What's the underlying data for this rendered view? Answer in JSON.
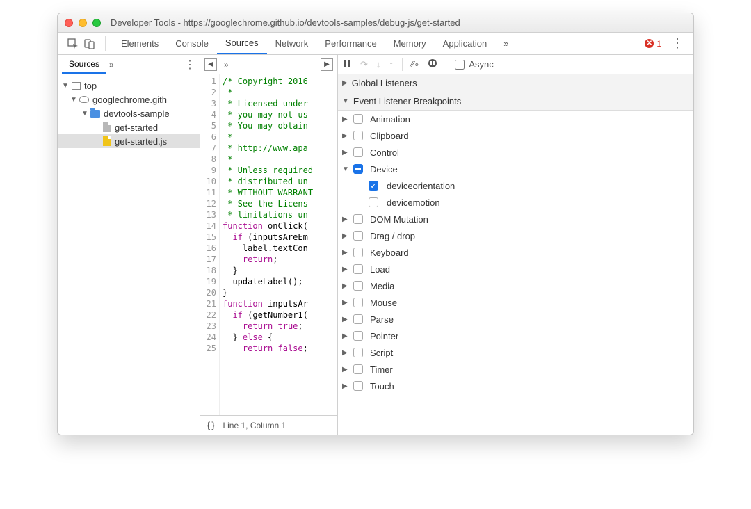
{
  "window": {
    "title": "Developer Tools - https://googlechrome.github.io/devtools-samples/debug-js/get-started"
  },
  "tabs": {
    "items": [
      "Elements",
      "Console",
      "Sources",
      "Network",
      "Performance",
      "Memory",
      "Application"
    ],
    "active": "Sources",
    "overflow": "»",
    "error_count": "1"
  },
  "left": {
    "tab": "Sources",
    "overflow": "»",
    "tree": {
      "top": "top",
      "domain": "googlechrome.gith",
      "folder": "devtools-sample",
      "file1": "get-started",
      "file2": "get-started.js"
    }
  },
  "editor": {
    "status": "Line 1, Column 1",
    "lines": [
      {
        "n": "1",
        "cls": "c-comm",
        "t": "/* Copyright 2016"
      },
      {
        "n": "2",
        "cls": "c-comm",
        "t": " *"
      },
      {
        "n": "3",
        "cls": "c-comm",
        "t": " * Licensed under"
      },
      {
        "n": "4",
        "cls": "c-comm",
        "t": " * you may not us"
      },
      {
        "n": "5",
        "cls": "c-comm",
        "t": " * You may obtain"
      },
      {
        "n": "6",
        "cls": "c-comm",
        "t": " *"
      },
      {
        "n": "7",
        "cls": "c-comm",
        "t": " * http://www.apa"
      },
      {
        "n": "8",
        "cls": "c-comm",
        "t": " *"
      },
      {
        "n": "9",
        "cls": "c-comm",
        "t": " * Unless required"
      },
      {
        "n": "10",
        "cls": "c-comm",
        "t": " * distributed un"
      },
      {
        "n": "11",
        "cls": "c-comm",
        "t": " * WITHOUT WARRANT"
      },
      {
        "n": "12",
        "cls": "c-comm",
        "t": " * See the Licens"
      },
      {
        "n": "13",
        "cls": "c-comm",
        "t": " * limitations un"
      },
      {
        "n": "14",
        "cls": "",
        "t": "<span class='c-kw'>function</span> onClick("
      },
      {
        "n": "15",
        "cls": "",
        "t": "  <span class='c-kw'>if</span> (inputsAreEm"
      },
      {
        "n": "16",
        "cls": "",
        "t": "    label.textCon"
      },
      {
        "n": "17",
        "cls": "",
        "t": "    <span class='c-kw'>return</span>;"
      },
      {
        "n": "18",
        "cls": "",
        "t": "  }"
      },
      {
        "n": "19",
        "cls": "",
        "t": "  updateLabel();"
      },
      {
        "n": "20",
        "cls": "",
        "t": "}"
      },
      {
        "n": "21",
        "cls": "",
        "t": "<span class='c-kw'>function</span> inputsAr"
      },
      {
        "n": "22",
        "cls": "",
        "t": "  <span class='c-kw'>if</span> (getNumber1("
      },
      {
        "n": "23",
        "cls": "",
        "t": "    <span class='c-kw'>return</span> <span class='c-kw'>true</span>;"
      },
      {
        "n": "24",
        "cls": "",
        "t": "  } <span class='c-kw'>else</span> {"
      },
      {
        "n": "25",
        "cls": "",
        "t": "    <span class='c-kw'>return</span> <span class='c-kw'>false</span>;"
      }
    ]
  },
  "debugger": {
    "async_label": "Async",
    "sections": {
      "global_listeners": "Global Listeners",
      "event_bp": "Event Listener Breakpoints"
    },
    "categories": [
      {
        "name": "Animation",
        "expanded": false,
        "state": "empty"
      },
      {
        "name": "Clipboard",
        "expanded": false,
        "state": "empty"
      },
      {
        "name": "Control",
        "expanded": false,
        "state": "empty"
      },
      {
        "name": "Device",
        "expanded": true,
        "state": "mixed",
        "children": [
          {
            "name": "deviceorientation",
            "checked": true
          },
          {
            "name": "devicemotion",
            "checked": false
          }
        ]
      },
      {
        "name": "DOM Mutation",
        "expanded": false,
        "state": "empty"
      },
      {
        "name": "Drag / drop",
        "expanded": false,
        "state": "empty"
      },
      {
        "name": "Keyboard",
        "expanded": false,
        "state": "empty"
      },
      {
        "name": "Load",
        "expanded": false,
        "state": "empty"
      },
      {
        "name": "Media",
        "expanded": false,
        "state": "empty"
      },
      {
        "name": "Mouse",
        "expanded": false,
        "state": "empty"
      },
      {
        "name": "Parse",
        "expanded": false,
        "state": "empty"
      },
      {
        "name": "Pointer",
        "expanded": false,
        "state": "empty"
      },
      {
        "name": "Script",
        "expanded": false,
        "state": "empty"
      },
      {
        "name": "Timer",
        "expanded": false,
        "state": "empty"
      },
      {
        "name": "Touch",
        "expanded": false,
        "state": "empty"
      }
    ]
  }
}
